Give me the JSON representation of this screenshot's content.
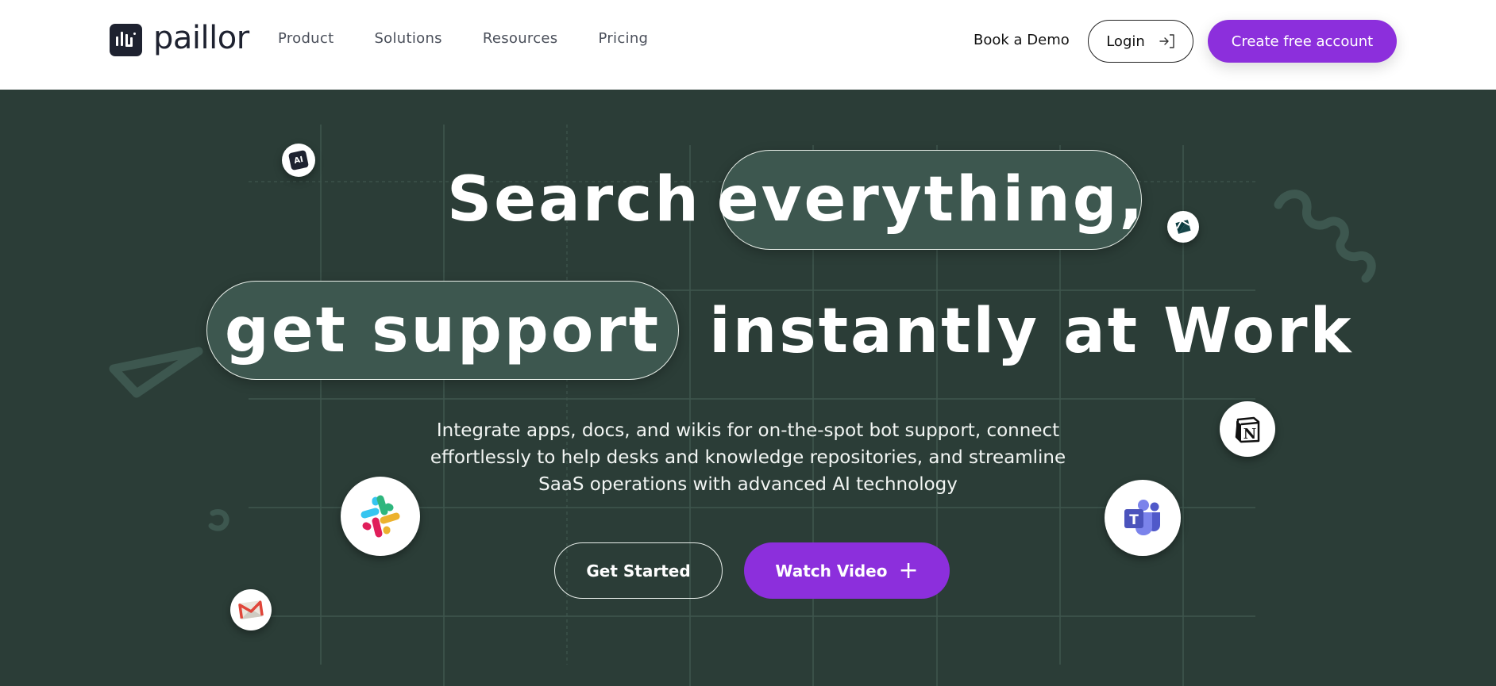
{
  "header": {
    "brand": "paillor",
    "nav": [
      {
        "label": "Product"
      },
      {
        "label": "Solutions"
      },
      {
        "label": "Resources"
      },
      {
        "label": "Pricing"
      }
    ],
    "book_demo": "Book a Demo",
    "login": "Login",
    "login_icon": "sign-in-icon",
    "create_account": "Create free account"
  },
  "hero": {
    "line1_plain": "Search",
    "line1_pill": "everything,",
    "line2_pill": "get support",
    "line2_plain": "instantly at Work",
    "subtitle_lines": [
      "Integrate apps, docs, and wikis for on-the-spot bot support, connect",
      "effortlessly to help desks and knowledge repositories, and streamline",
      "SaaS operations with advanced AI technology"
    ],
    "get_started": "Get Started",
    "watch_video": "Watch Video",
    "watch_video_icon": "plus-icon",
    "integration_icons": [
      "ai-icon",
      "zendesk-icon",
      "notion-icon",
      "microsoft-teams-icon",
      "slack-icon",
      "gmail-icon"
    ]
  },
  "colors": {
    "accent": "#8c2fdc",
    "hero_bg": "#2b3d37",
    "pill_bg": "#3d574f",
    "grid_line": "#3f564e",
    "header_bg": "#ffffff",
    "logo_dark": "#1e2230"
  }
}
